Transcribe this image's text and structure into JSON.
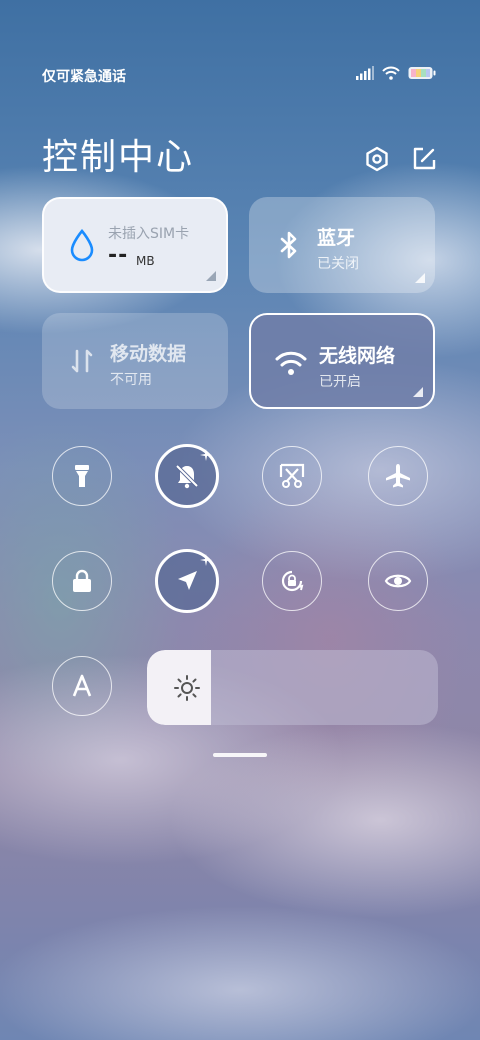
{
  "status_bar": {
    "carrier": "仅可紧急通话"
  },
  "header": {
    "title": "控制中心"
  },
  "tiles": {
    "sim": {
      "label": "未插入SIM卡",
      "value": "--",
      "unit": "MB"
    },
    "bluetooth": {
      "label": "蓝牙",
      "state": "已关闭"
    },
    "mobile_data": {
      "label": "移动数据",
      "state": "不可用"
    },
    "wifi": {
      "label": "无线网络",
      "state": "已开启"
    }
  },
  "toggles": [
    {
      "name": "flashlight",
      "icon": "flashlight-icon",
      "active": false
    },
    {
      "name": "silent",
      "icon": "bell-off-icon",
      "active": true
    },
    {
      "name": "screenshot",
      "icon": "scissors-icon",
      "active": false
    },
    {
      "name": "airplane",
      "icon": "airplane-icon",
      "active": false
    },
    {
      "name": "lock",
      "icon": "lock-icon",
      "active": false
    },
    {
      "name": "location",
      "icon": "location-arrow-icon",
      "active": true
    },
    {
      "name": "rotation-lock",
      "icon": "rotation-lock-icon",
      "active": false
    },
    {
      "name": "reading-mode",
      "icon": "eye-icon",
      "active": false
    },
    {
      "name": "auto-brightness",
      "icon": "letter-a-icon",
      "active": false
    }
  ],
  "brightness": {
    "level": 0.22,
    "icon": "sun-icon"
  },
  "colors": {
    "accent": "#1a8cff",
    "wifi_active": "#707ea8",
    "sim_bg": "#e8ecf4"
  }
}
